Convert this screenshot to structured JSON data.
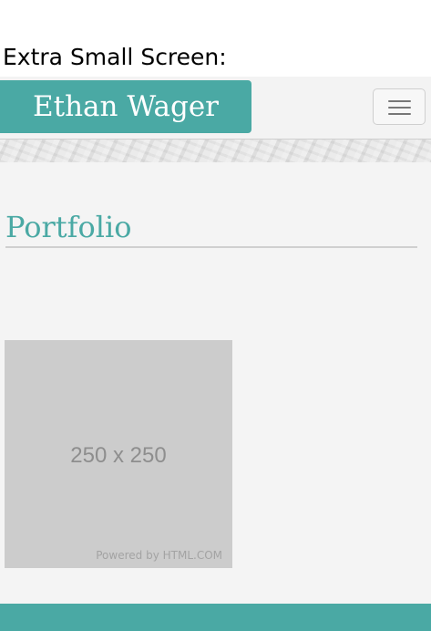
{
  "caption": "Extra Small Screen:",
  "navbar": {
    "brand": "Ethan Wager",
    "toggler_icon": "hamburger-menu-icon"
  },
  "main": {
    "section_title": "Portfolio",
    "placeholder": {
      "dimensions": "250 x 250",
      "credit": "Powered by HTML.COM"
    }
  },
  "colors": {
    "accent": "#4aa9a4",
    "page_background": "#f4f4f4",
    "placeholder_background": "#cccccc"
  }
}
